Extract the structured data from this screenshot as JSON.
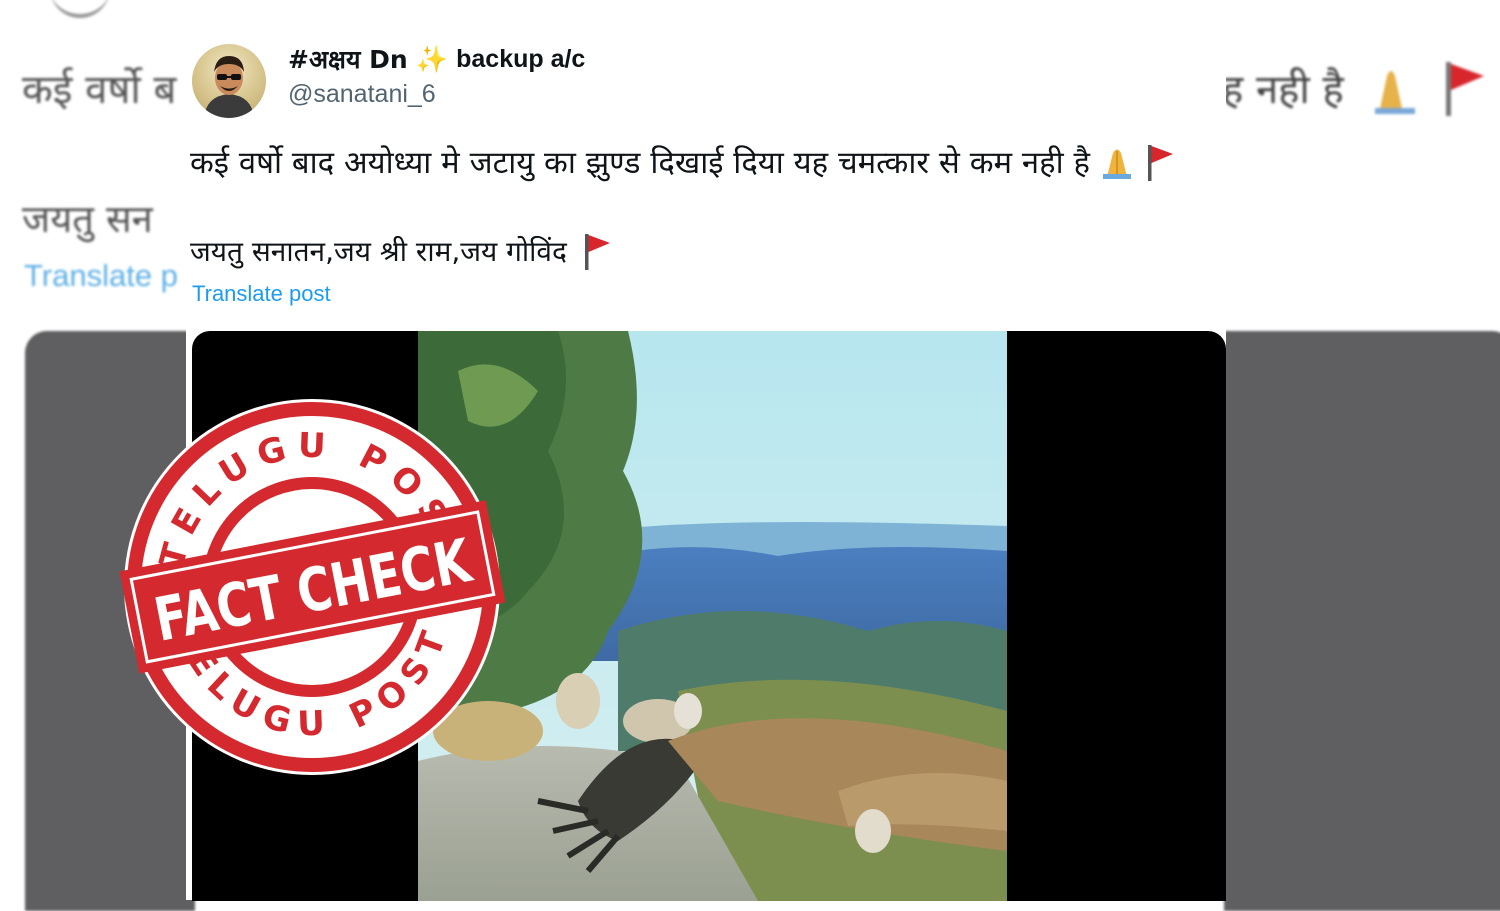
{
  "background_tweet": {
    "line1_left": "कई वर्षो ब",
    "line1_right": "ह नही है",
    "line2": "जयतु सन",
    "translate": "Translate p"
  },
  "tweet": {
    "author_name_prefix": "#अक्षय Dn",
    "author_name_suffix": "backup a/c",
    "author_handle": "@sanatani_6",
    "text_line1": "कई वर्षो बाद अयोध्या मे जटायु का झुण्ड दिखाई दिया यह चमत्कार से कम नही है",
    "text_line2": "जयतु सनातन,जय श्री राम,जय गोविंद",
    "translate_label": "Translate post",
    "icons": {
      "sparkle": "sparkle-icon",
      "pray": "folded-hands-emoji",
      "flag": "red-triangular-flag-emoji"
    }
  },
  "stamp": {
    "top_arc": "TELUGU POST",
    "bottom_arc": "TELUGU POST",
    "banner": "FACT CHECK",
    "color": "#d42a2f"
  },
  "colors": {
    "link": "#1d9bf0",
    "handle": "#536471",
    "flag": "#d8262d"
  }
}
